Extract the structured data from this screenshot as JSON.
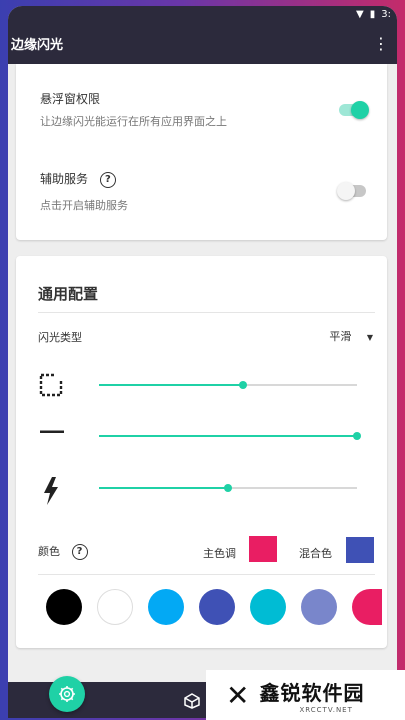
{
  "status": {
    "time_partial": "3:"
  },
  "appbar": {
    "title": "边缘闪光",
    "menu_icon": "more-vert-icon"
  },
  "permissions": {
    "overlay": {
      "title": "悬浮窗权限",
      "subtitle": "让边缘闪光能运行在所有应用界面之上",
      "enabled": true
    },
    "accessibility": {
      "title": "辅助服务",
      "subtitle": "点击开启辅助服务",
      "enabled": false
    }
  },
  "general": {
    "title": "通用配置",
    "flash_type": {
      "label": "闪光类型",
      "value": "平滑"
    },
    "sliders": [
      {
        "icon": "crop-corner-icon",
        "value": 0.56
      },
      {
        "icon": "line-thickness-icon",
        "value": 1.0
      },
      {
        "icon": "flash-icon",
        "value": 0.5
      }
    ],
    "colors": {
      "label": "颜色",
      "primary_label": "主色调",
      "mix_label": "混合色",
      "primary_color": "#e91e63",
      "mix_color": "#3f51b5"
    },
    "palette": [
      "#000000",
      "#ffffff",
      "#03a9f4",
      "#3f51b5",
      "#00bcd4",
      "#7986cb",
      "#e91e63"
    ]
  },
  "watermark": {
    "main": "鑫锐软件园",
    "sub": "XRCCTV.NET"
  }
}
